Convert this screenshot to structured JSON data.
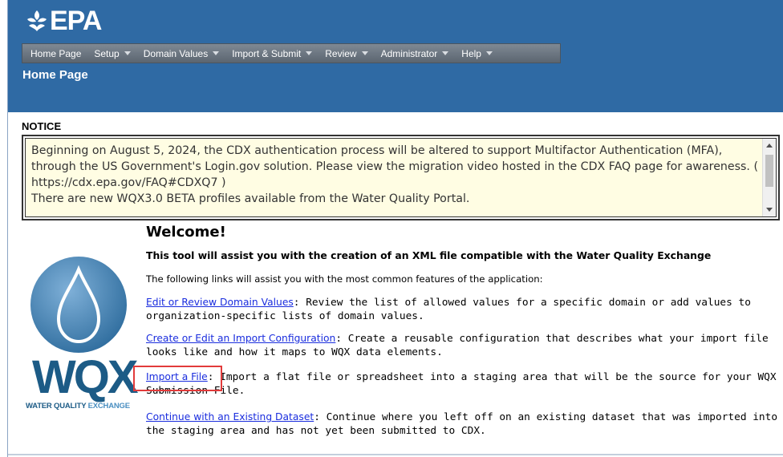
{
  "header": {
    "logo_text": "EPA",
    "page_title": "Home Page",
    "menu": [
      {
        "label": "Home Page",
        "has_dropdown": false
      },
      {
        "label": "Setup",
        "has_dropdown": true
      },
      {
        "label": "Domain Values",
        "has_dropdown": true
      },
      {
        "label": "Import & Submit",
        "has_dropdown": true
      },
      {
        "label": "Review",
        "has_dropdown": true
      },
      {
        "label": "Administrator",
        "has_dropdown": true
      },
      {
        "label": "Help",
        "has_dropdown": true
      }
    ]
  },
  "notice": {
    "label": "NOTICE",
    "lines": [
      "Beginning on August 5, 2024, the CDX authentication process will be altered to support Multifactor Authentication (MFA), through the US Government's Login.gov solution. Please view the migration video hosted in the CDX FAQ page for awareness. ( https://cdx.epa.gov/FAQ#CDXQ7 )",
      "There are new WQX3.0 BETA profiles available from the Water Quality Portal."
    ]
  },
  "wqx_logo": {
    "wordmark": "WQX",
    "subtitle_a": "WATER QUALITY",
    "subtitle_b": "EXCHANGE"
  },
  "welcome": {
    "title": "Welcome!",
    "intro": "This tool will assist you with the creation of an XML file compatible with the Water Quality Exchange",
    "lead": "The following links will assist you with the most common features of the application:",
    "features": [
      {
        "link": "Edit or Review Domain Values",
        "desc": ":  Review the list of allowed values for a specific domain or add values to organization-specific lists of domain values."
      },
      {
        "link": "Create or Edit an Import Configuration",
        "desc": ":  Create a reusable configuration that describes what your import file looks like and how it maps to WQX data elements."
      },
      {
        "link": "Import a File",
        "desc": ": Import a flat file or spreadsheet into a staging area that will be the source for your WQX Submission File."
      },
      {
        "link": "Continue with an Existing Dataset",
        "desc": ":  Continue where you left off on an existing dataset that was imported into the staging area and has not yet been submitted to CDX."
      }
    ]
  },
  "colors": {
    "header_bg": "#2f6aa4",
    "menubar_bg": "#6b7580",
    "notice_bg": "#fffde3",
    "link": "#1a2dde",
    "highlight": "#e23b3b",
    "wqx_blue": "#1c5b86"
  },
  "icons": {
    "logo": "epa-flower-icon",
    "drop": "water-drop-icon",
    "caret": "caret-down-icon"
  }
}
